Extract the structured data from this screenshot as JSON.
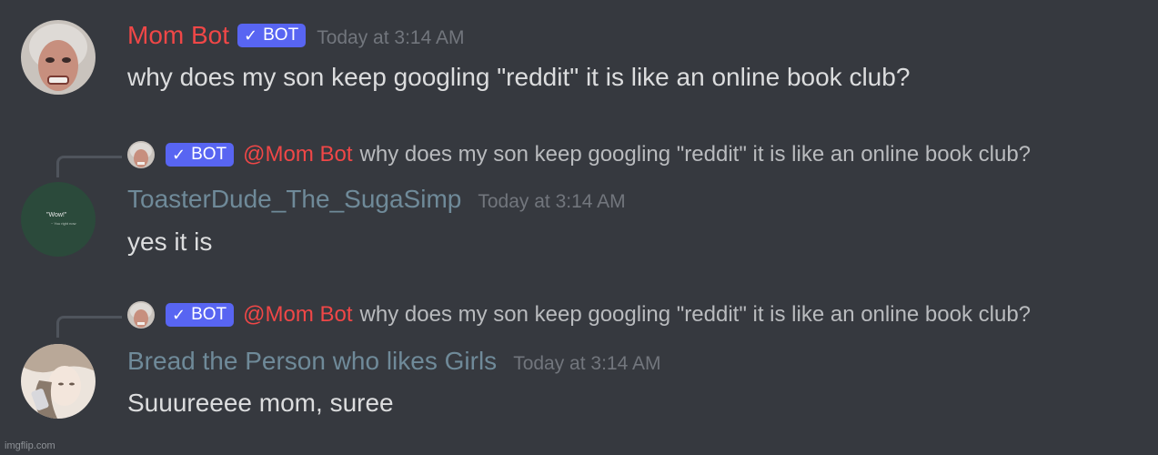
{
  "messages": [
    {
      "author": "Mom Bot",
      "author_color": "#f04747",
      "badge": "BOT",
      "timestamp": "Today at 3:14 AM",
      "content": "why does my son keep googling \"reddit\" it is like an online book club?"
    },
    {
      "reply": {
        "badge": "BOT",
        "mention": "@Mom Bot",
        "text": "why does my son keep googling \"reddit\" it is like an online book club?"
      },
      "author": "ToasterDude_The_SugaSimp",
      "author_color": "#6f8a99",
      "timestamp": "Today at 3:14 AM",
      "content": "yes it is",
      "avatar_text": "\"Wow!\"",
      "avatar_subtext": "~ You right now"
    },
    {
      "reply": {
        "badge": "BOT",
        "mention": "@Mom Bot",
        "text": "why does my son keep googling \"reddit\" it is like an online book club?"
      },
      "author": "Bread the Person who likes Girls",
      "author_color": "#6f8a99",
      "timestamp": "Today at 3:14 AM",
      "content": "Suuureeee mom, suree"
    }
  ],
  "watermark": "imgflip.com",
  "colors": {
    "background": "#36393f",
    "bot_badge": "#5865f2",
    "mention": "#f04747",
    "message_text": "#dcddde",
    "timestamp": "#72767d"
  },
  "icons": {
    "badge_check": "checkmark-icon"
  }
}
